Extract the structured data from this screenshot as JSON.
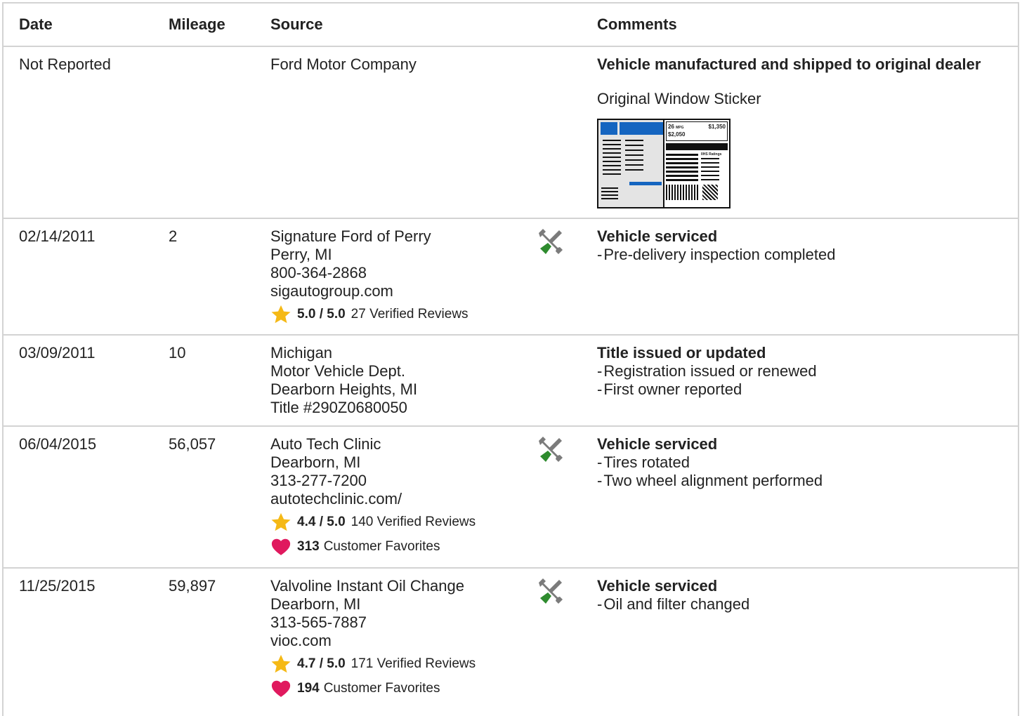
{
  "headers": {
    "date": "Date",
    "mileage": "Mileage",
    "source": "Source",
    "comments": "Comments"
  },
  "rows": [
    {
      "date": "Not Reported",
      "mileage": "",
      "source": [
        "Ford Motor Company"
      ],
      "comment_title": "Vehicle manufactured and shipped to original dealer",
      "sticker_label": "Original Window Sticker",
      "sticker_text": {
        "mpg": "26",
        "mpg_unit": "MPG",
        "save": "$1,350",
        "cost": "$2,050",
        "ratings": "IIHS Ratings"
      }
    },
    {
      "date": "02/14/2011",
      "mileage": "2",
      "source": [
        "Signature Ford of Perry",
        "Perry, MI",
        "800-364-2868",
        "sigautogroup.com"
      ],
      "rating": {
        "score": "5.0 / 5.0",
        "reviews": "27 Verified Reviews"
      },
      "icon": "wrench-screwdriver-icon",
      "comment_title": "Vehicle serviced",
      "comment_items": [
        "Pre-delivery inspection completed"
      ]
    },
    {
      "date": "03/09/2011",
      "mileage": "10",
      "source": [
        "Michigan",
        "Motor Vehicle Dept.",
        "Dearborn Heights, MI",
        "Title #290Z0680050"
      ],
      "comment_title": "Title issued or updated",
      "comment_items": [
        "Registration issued or renewed",
        "First owner reported"
      ]
    },
    {
      "date": "06/04/2015",
      "mileage": "56,057",
      "source": [
        "Auto Tech Clinic",
        "Dearborn, MI",
        "313-277-7200",
        "autotechclinic.com/"
      ],
      "rating": {
        "score": "4.4 / 5.0",
        "reviews": "140 Verified Reviews"
      },
      "favorites": {
        "count": "313",
        "label": "Customer Favorites"
      },
      "icon": "wrench-screwdriver-icon",
      "comment_title": "Vehicle serviced",
      "comment_items": [
        "Tires rotated",
        "Two wheel alignment performed"
      ]
    },
    {
      "date": "11/25/2015",
      "mileage": "59,897",
      "source": [
        "Valvoline Instant Oil Change",
        "Dearborn, MI",
        "313-565-7887",
        "vioc.com"
      ],
      "rating": {
        "score": "4.7 / 5.0",
        "reviews": "171 Verified Reviews"
      },
      "favorites": {
        "count": "194",
        "label": "Customer Favorites"
      },
      "icon": "wrench-screwdriver-icon",
      "comment_title": "Vehicle serviced",
      "comment_items": [
        "Oil and filter changed"
      ]
    }
  ],
  "colors": {
    "star": "#f5b916",
    "heart": "#e0195e",
    "wrench": "#7b7b7b",
    "screwdriver": "#2e8b2e",
    "border": "#d3d3d3",
    "sticker_blue": "#1565c0"
  }
}
